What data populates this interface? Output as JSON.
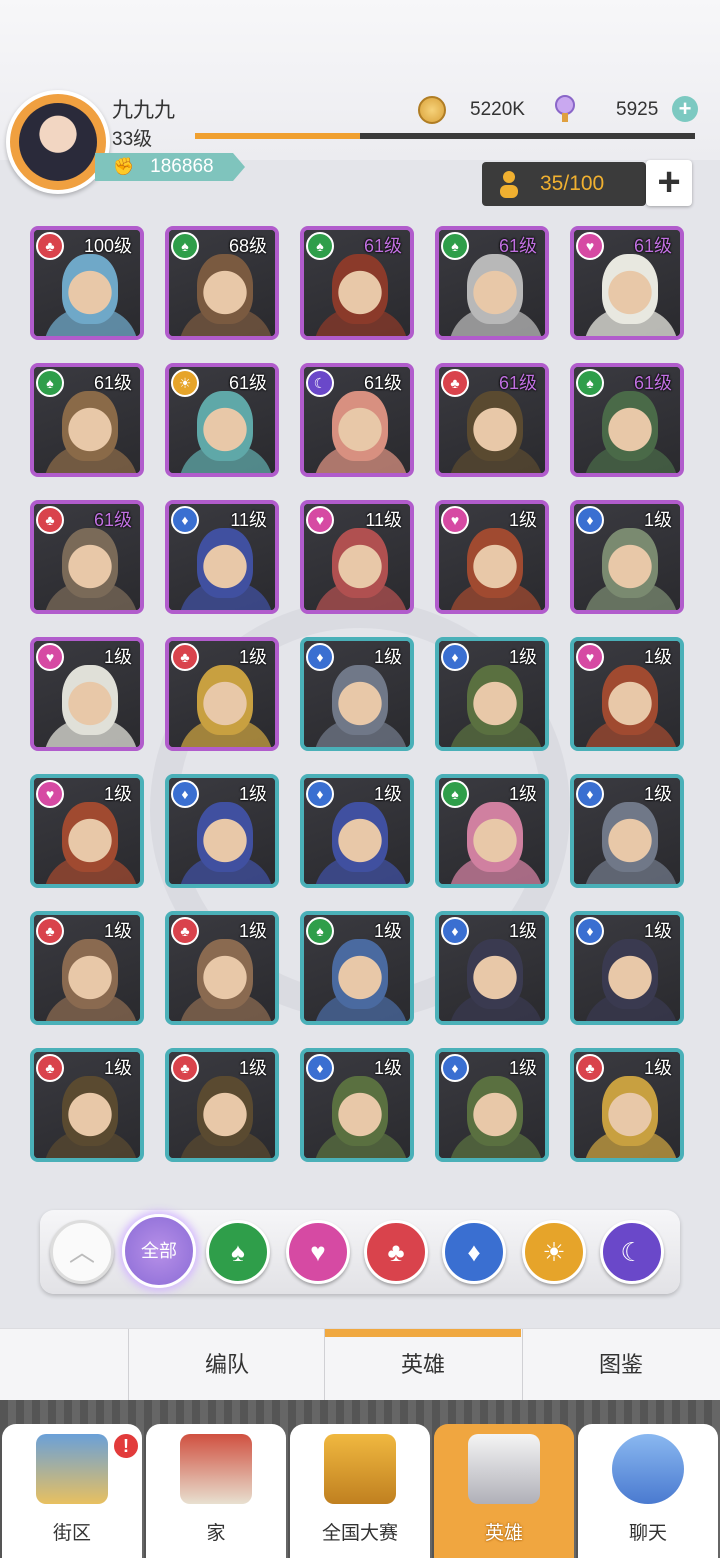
{
  "player": {
    "name": "九九九",
    "level": "33级",
    "xp_progress": 0.33,
    "power": "186868"
  },
  "resources": {
    "coins": "5220K",
    "gems": "5925",
    "add_label": "+"
  },
  "roster": {
    "count": "35/100",
    "add_label": "+"
  },
  "heroes": [
    {
      "level": "100级",
      "faction": "red",
      "frame": "purple",
      "lvl_style": "white",
      "tone": "#6fa8c8"
    },
    {
      "level": "68级",
      "faction": "green",
      "frame": "purple",
      "lvl_style": "white",
      "tone": "#7a5a40"
    },
    {
      "level": "61级",
      "faction": "green",
      "frame": "purple",
      "lvl_style": "purple",
      "tone": "#8b3a2a"
    },
    {
      "level": "61级",
      "faction": "green",
      "frame": "purple",
      "lvl_style": "purple",
      "tone": "#b8b8b8"
    },
    {
      "level": "61级",
      "faction": "pink",
      "frame": "purple",
      "lvl_style": "purple",
      "tone": "#e8e8e0"
    },
    {
      "level": "61级",
      "faction": "green",
      "frame": "purple",
      "lvl_style": "white",
      "tone": "#8a6a48"
    },
    {
      "level": "61级",
      "faction": "gold",
      "frame": "purple",
      "lvl_style": "white",
      "tone": "#5fa8a8"
    },
    {
      "level": "61级",
      "faction": "purple",
      "frame": "purple",
      "lvl_style": "white",
      "tone": "#d89080"
    },
    {
      "level": "61级",
      "faction": "red",
      "frame": "purple",
      "lvl_style": "purple",
      "tone": "#5a4a30"
    },
    {
      "level": "61级",
      "faction": "green",
      "frame": "purple",
      "lvl_style": "purple",
      "tone": "#4a6a48"
    },
    {
      "level": "61级",
      "faction": "red",
      "frame": "purple",
      "lvl_style": "purple",
      "tone": "#7a6a58"
    },
    {
      "level": "11级",
      "faction": "blue",
      "frame": "purple",
      "lvl_style": "white",
      "tone": "#4050a0"
    },
    {
      "level": "11级",
      "faction": "pink",
      "frame": "purple",
      "lvl_style": "white",
      "tone": "#b05050"
    },
    {
      "level": "1级",
      "faction": "pink",
      "frame": "purple",
      "lvl_style": "white",
      "tone": "#a04a30"
    },
    {
      "level": "1级",
      "faction": "blue",
      "frame": "purple",
      "lvl_style": "white",
      "tone": "#7a8a70"
    },
    {
      "level": "1级",
      "faction": "pink",
      "frame": "purple",
      "lvl_style": "white",
      "tone": "#e0e0d8"
    },
    {
      "level": "1级",
      "faction": "red",
      "frame": "purple",
      "lvl_style": "white",
      "tone": "#c8a040"
    },
    {
      "level": "1级",
      "faction": "blue",
      "frame": "teal",
      "lvl_style": "white",
      "tone": "#707888"
    },
    {
      "level": "1级",
      "faction": "blue",
      "frame": "teal",
      "lvl_style": "white",
      "tone": "#5a7040"
    },
    {
      "level": "1级",
      "faction": "pink",
      "frame": "teal",
      "lvl_style": "white",
      "tone": "#a04a30"
    },
    {
      "level": "1级",
      "faction": "pink",
      "frame": "teal",
      "lvl_style": "white",
      "tone": "#a04a30"
    },
    {
      "level": "1级",
      "faction": "blue",
      "frame": "teal",
      "lvl_style": "white",
      "tone": "#4050a0"
    },
    {
      "level": "1级",
      "faction": "blue",
      "frame": "teal",
      "lvl_style": "white",
      "tone": "#4050a0"
    },
    {
      "level": "1级",
      "faction": "green",
      "frame": "teal",
      "lvl_style": "white",
      "tone": "#d080a0"
    },
    {
      "level": "1级",
      "faction": "blue",
      "frame": "teal",
      "lvl_style": "white",
      "tone": "#707888"
    },
    {
      "level": "1级",
      "faction": "red",
      "frame": "teal",
      "lvl_style": "white",
      "tone": "#8a6a50"
    },
    {
      "level": "1级",
      "faction": "red",
      "frame": "teal",
      "lvl_style": "white",
      "tone": "#8a6a50"
    },
    {
      "level": "1级",
      "faction": "green",
      "frame": "teal",
      "lvl_style": "white",
      "tone": "#4a6aa0"
    },
    {
      "level": "1级",
      "faction": "blue",
      "frame": "teal",
      "lvl_style": "white",
      "tone": "#3a3a50"
    },
    {
      "level": "1级",
      "faction": "blue",
      "frame": "teal",
      "lvl_style": "white",
      "tone": "#3a3a50"
    },
    {
      "level": "1级",
      "faction": "red",
      "frame": "teal",
      "lvl_style": "white",
      "tone": "#5a4a30"
    },
    {
      "level": "1级",
      "faction": "red",
      "frame": "teal",
      "lvl_style": "white",
      "tone": "#5a4a30"
    },
    {
      "level": "1级",
      "faction": "blue",
      "frame": "teal",
      "lvl_style": "white",
      "tone": "#5a7040"
    },
    {
      "level": "1级",
      "faction": "blue",
      "frame": "teal",
      "lvl_style": "white",
      "tone": "#5a7040"
    },
    {
      "level": "1级",
      "faction": "red",
      "frame": "teal",
      "lvl_style": "white",
      "tone": "#c8a040"
    }
  ],
  "filters": {
    "collapse_icon": "chevron-up-icon",
    "all_label": "全部",
    "factions": [
      {
        "name": "green",
        "icon": "spade-icon",
        "glyph": "♠"
      },
      {
        "name": "pink",
        "icon": "heart-icon",
        "glyph": "♥"
      },
      {
        "name": "red",
        "icon": "club-icon",
        "glyph": "♣"
      },
      {
        "name": "blue",
        "icon": "diamond-icon",
        "glyph": "♦"
      },
      {
        "name": "gold",
        "icon": "sun-icon",
        "glyph": "☀"
      },
      {
        "name": "purple",
        "icon": "moon-icon",
        "glyph": "☾"
      }
    ]
  },
  "tabs": {
    "formation": "编队",
    "heroes": "英雄",
    "codex": "图鉴"
  },
  "nav": {
    "district": "街区",
    "home": "家",
    "contest": "全国大赛",
    "heroes": "英雄",
    "chat": "聊天",
    "badge": "!"
  },
  "colors": {
    "accent": "#f0a640",
    "purple_frame": "#b15ccc",
    "teal_frame": "#4ab0b8",
    "power": "#7fc4bd"
  }
}
